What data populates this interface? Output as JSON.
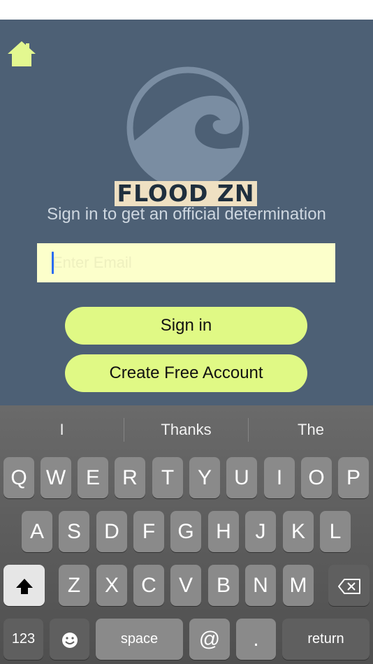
{
  "app": {
    "logo_text": "FLOOD ZN",
    "subtitle": "Sign in to get an official determination",
    "email": {
      "placeholder": "Enter Email",
      "value": ""
    },
    "signin_label": "Sign in",
    "create_account_label": "Create Free Account",
    "colors": {
      "background": "#4d6075",
      "accent": "#e0f985",
      "input_bg": "#fcffcb",
      "home_icon": "#e3f890"
    },
    "icons": {
      "home": "home-icon",
      "logo": "wave-icon"
    }
  },
  "keyboard": {
    "suggestions": [
      "I",
      "Thanks",
      "The"
    ],
    "row1": [
      "Q",
      "W",
      "E",
      "R",
      "T",
      "Y",
      "U",
      "I",
      "O",
      "P"
    ],
    "row2": [
      "A",
      "S",
      "D",
      "F",
      "G",
      "H",
      "J",
      "K",
      "L"
    ],
    "row3": [
      "Z",
      "X",
      "C",
      "V",
      "B",
      "N",
      "M"
    ],
    "bottom": {
      "numbers": "123",
      "space": "space",
      "at": "@",
      "dot": ".",
      "return": "return"
    },
    "icons": {
      "shift": "shift-icon",
      "backspace": "backspace-icon",
      "emoji": "emoji-icon"
    }
  }
}
